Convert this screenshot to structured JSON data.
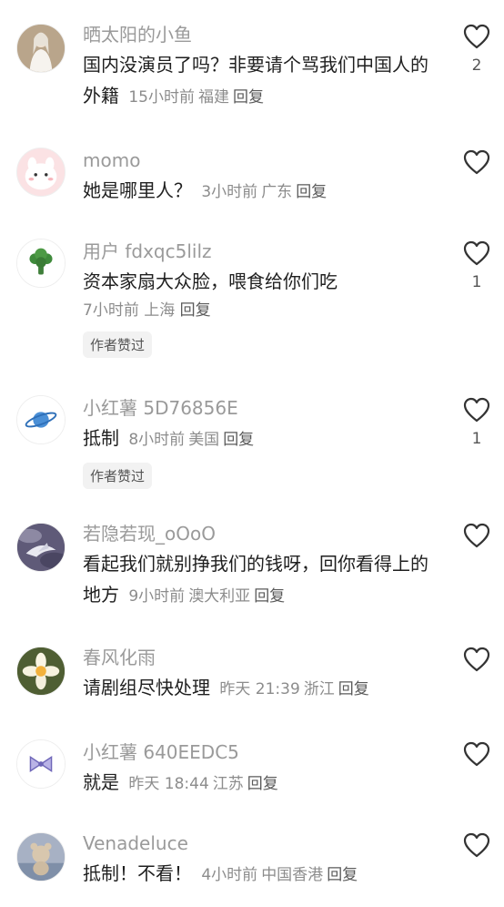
{
  "comments": [
    {
      "username": "晒太阳的小鱼",
      "text": "国内没演员了吗？非要请个骂我们中国人的外籍",
      "time": "15小时前",
      "location": "福建",
      "reply": "回复",
      "likes": "2",
      "badge": "",
      "avatar_icon": "person-in-white-avatar-icon"
    },
    {
      "username": "momo",
      "text": "她是哪里人？",
      "time": "3小时前",
      "location": "广东",
      "reply": "回复",
      "likes": "",
      "badge": "",
      "avatar_icon": "pink-bunny-avatar-icon"
    },
    {
      "username": "用户 fdxqc5lilz",
      "text": "资本家扇大众脸，喂食给你们吃",
      "time": "7小时前",
      "location": "上海",
      "reply": "回复",
      "likes": "1",
      "badge": "作者赞过",
      "avatar_icon": "broccoli-avatar-icon"
    },
    {
      "username": "小红薯 5D76856E",
      "text": "抵制",
      "time": "8小时前",
      "location": "美国",
      "reply": "回复",
      "likes": "1",
      "badge": "作者赞过",
      "avatar_icon": "planet-avatar-icon"
    },
    {
      "username": "若隐若现_oOoO",
      "text": "看起我们就别挣我们的钱呀，回你看得上的地方",
      "time": "9小时前",
      "location": "澳大利亚",
      "reply": "回复",
      "likes": "",
      "badge": "",
      "avatar_icon": "bird-in-clouds-avatar-icon"
    },
    {
      "username": "春风化雨",
      "text": "请剧组尽快处理",
      "time": "昨天 21:39",
      "location": "浙江",
      "reply": "回复",
      "likes": "",
      "badge": "",
      "avatar_icon": "daffodil-avatar-icon"
    },
    {
      "username": "小红薯 640EEDC5",
      "text": "就是",
      "time": "昨天 18:44",
      "location": "江苏",
      "reply": "回复",
      "likes": "",
      "badge": "",
      "avatar_icon": "bow-avatar-icon"
    },
    {
      "username": "Venadeluce",
      "text": "抵制！不看！",
      "time": "4小时前",
      "location": "中国香港",
      "reply": "回复",
      "likes": "",
      "badge": "",
      "avatar_icon": "plush-toy-avatar-icon"
    }
  ],
  "colors": {
    "username": "#9a9a9a",
    "text": "#1f1f1f",
    "meta": "#8c8c8c",
    "heart_stroke": "#333333",
    "badge_bg": "#f2f2f2"
  }
}
